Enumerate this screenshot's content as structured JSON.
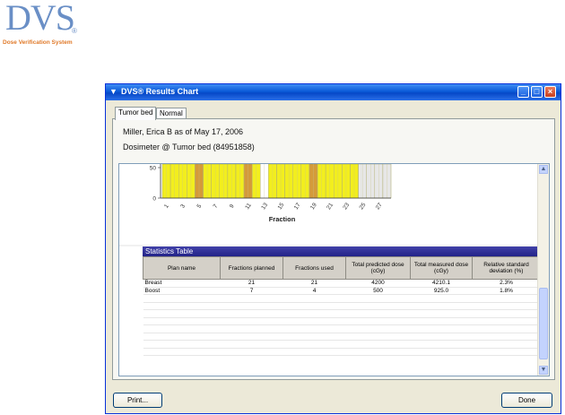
{
  "logo": {
    "word": "DVS",
    "reg": "®",
    "tagline": "Dose Verification System"
  },
  "window": {
    "title": "DVS® Results Chart",
    "controls": {
      "minimize": "_",
      "maximize": "□",
      "close": "×"
    }
  },
  "tabs": [
    {
      "label": "Tumor bed",
      "active": true
    },
    {
      "label": "Normal",
      "active": false
    }
  ],
  "info": {
    "patient_line": "Miller, Erica B as of May 17, 2006",
    "dosimeter_line": "Dosimeter @ Tumor bed (84951858)"
  },
  "chart_data": {
    "type": "bar",
    "xlabel": "Fraction",
    "ylabel": "",
    "x_ticks": [
      "1",
      "3",
      "5",
      "7",
      "9",
      "11",
      "13",
      "15",
      "17",
      "19",
      "21",
      "23",
      "25",
      "27"
    ],
    "y_ticks": [
      "0",
      "50"
    ],
    "ylim": [
      0,
      100
    ],
    "fractions": [
      1,
      2,
      3,
      4,
      5,
      6,
      7,
      8,
      9,
      10,
      11,
      12,
      13,
      14,
      15,
      16,
      17,
      18,
      19,
      20,
      21,
      22,
      23,
      24,
      25,
      26,
      27,
      28
    ],
    "values": [
      100,
      100,
      100,
      100,
      100,
      100,
      100,
      100,
      100,
      100,
      100,
      100,
      0,
      100,
      100,
      100,
      100,
      100,
      100,
      100,
      100,
      100,
      100,
      100,
      100,
      100,
      100,
      100
    ],
    "colors": [
      "#f2ee1e",
      "#f2ee1e",
      "#f2ee1e",
      "#f2ee1e",
      "#d49a3a",
      "#f2ee1e",
      "#f2ee1e",
      "#f2ee1e",
      "#f2ee1e",
      "#f2ee1e",
      "#d49a3a",
      "#f2ee1e",
      "#ffffff",
      "#f2ee1e",
      "#f2ee1e",
      "#f2ee1e",
      "#f2ee1e",
      "#f2ee1e",
      "#d49a3a",
      "#f2ee1e",
      "#f2ee1e",
      "#f2ee1e",
      "#f2ee1e",
      "#f2ee1e",
      "#e7e7e7",
      "#e7e7e7",
      "#e7e7e7",
      "#e7e7e7"
    ],
    "grid": true
  },
  "statistics": {
    "title": "Statistics Table",
    "columns": [
      "Plan name",
      "Fractions planned",
      "Fractions used",
      "Total predicted dose (cGy)",
      "Total measured dose (cGy)",
      "Relative standard deviation (%)"
    ],
    "rows": [
      [
        "Breast",
        "21",
        "21",
        "4200",
        "4210.1",
        "2.3%"
      ],
      [
        "Boost",
        "7",
        "4",
        "500",
        "925.0",
        "1.8%"
      ]
    ],
    "empty_rows": 8
  },
  "buttons": {
    "print": "Print...",
    "done": "Done"
  },
  "colors": {
    "accent": "#0a5ad8",
    "stats_header": "#222288",
    "bar_yellow": "#f2ee1e",
    "bar_orange": "#d49a3a"
  }
}
